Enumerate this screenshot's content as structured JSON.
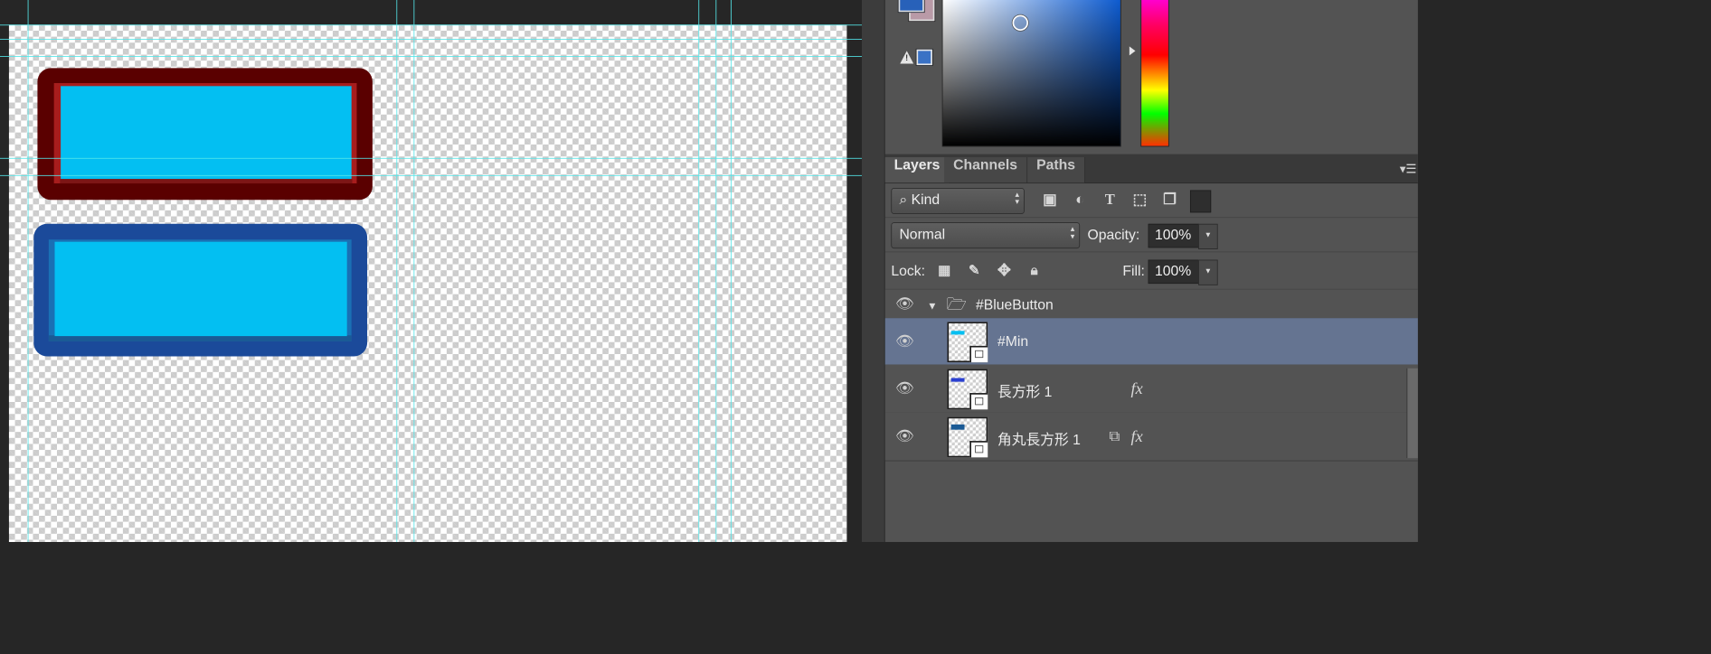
{
  "colors": {
    "canvas_red_outer": "#5a0000",
    "canvas_blue_outer": "#1b4a9a",
    "button_face": "#03bff2",
    "foreground_color": "#2861b9",
    "background_color": "#b99aa7",
    "selection_highlight": "#657491",
    "guide_color": "#54e6e9"
  },
  "layers_panel": {
    "tabs": [
      {
        "label": "Layers",
        "active": true
      },
      {
        "label": "Channels",
        "active": false
      },
      {
        "label": "Paths",
        "active": false
      }
    ],
    "filter": {
      "kind_label": "Kind",
      "icons": [
        "image-filter-icon",
        "adjustment-filter-icon",
        "type-filter-icon",
        "shape-filter-icon",
        "smart-object-filter-icon"
      ]
    },
    "blend": {
      "mode": "Normal",
      "opacity_label": "Opacity:",
      "opacity_value": "100%"
    },
    "lock": {
      "label": "Lock:",
      "fill_label": "Fill:",
      "fill_value": "100%"
    },
    "layers": [
      {
        "name": "#BlueButton",
        "type": "group",
        "expanded": true,
        "selected": false
      },
      {
        "name": "#Min",
        "type": "shape",
        "selected": true,
        "thumb_color": "#03bff2",
        "fx": false
      },
      {
        "name": "長方形 1",
        "type": "shape",
        "selected": false,
        "thumb_color": "#2a3fd0",
        "fx": true
      },
      {
        "name": "角丸長方形 1",
        "type": "shape",
        "selected": false,
        "thumb_color": "#1a5a95",
        "fx": true,
        "linked": true
      }
    ]
  }
}
